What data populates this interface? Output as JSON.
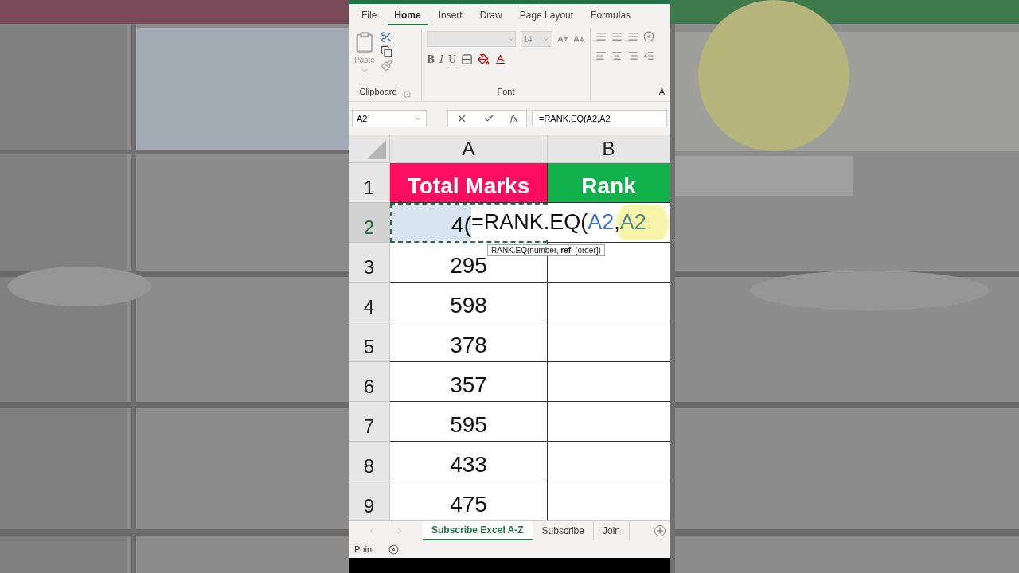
{
  "menu_tabs": [
    {
      "label": "File",
      "selected": false
    },
    {
      "label": "Home",
      "selected": true
    },
    {
      "label": "Insert",
      "selected": false
    },
    {
      "label": "Draw",
      "selected": false
    },
    {
      "label": "Page Layout",
      "selected": false
    },
    {
      "label": "Formulas",
      "selected": false
    }
  ],
  "ribbon": {
    "clipboard": {
      "paste_label": "Paste",
      "group_label": "Clipboard"
    },
    "font": {
      "font_size": "14",
      "style_buttons": [
        "B",
        "I",
        "U"
      ],
      "group_label": "Font"
    },
    "alignment": {
      "group_label": "A"
    }
  },
  "formula_bar": {
    "name_box": "A2",
    "fx": "fx",
    "formula": "=RANK.EQ(A2,A2"
  },
  "columns": [
    "A",
    "B"
  ],
  "rows": [
    {
      "number": "1",
      "kind": "header",
      "cells": [
        {
          "text": "Total Marks",
          "color": "#fc0d5f"
        },
        {
          "text": "Rank",
          "color": "#10b04a"
        }
      ]
    },
    {
      "number": "2",
      "kind": "editing",
      "cells": [
        {
          "text": "4("
        },
        {
          "text": ""
        }
      ]
    },
    {
      "number": "3",
      "kind": "value",
      "cells": [
        {
          "text": "295"
        }
      ]
    },
    {
      "number": "4",
      "kind": "value",
      "cells": [
        {
          "text": "598"
        }
      ]
    },
    {
      "number": "5",
      "kind": "value",
      "cells": [
        {
          "text": "378"
        }
      ]
    },
    {
      "number": "6",
      "kind": "value",
      "cells": [
        {
          "text": "357"
        }
      ]
    },
    {
      "number": "7",
      "kind": "value",
      "cells": [
        {
          "text": "595"
        }
      ]
    },
    {
      "number": "8",
      "kind": "value",
      "cells": [
        {
          "text": "433"
        }
      ]
    },
    {
      "number": "9",
      "kind": "value",
      "cells": [
        {
          "text": "475"
        }
      ]
    }
  ],
  "cell_editor": {
    "segments": [
      {
        "text": "=RANK.EQ(",
        "color": "#111111"
      },
      {
        "text": "A2",
        "color": "#3b6fd0"
      },
      {
        "text": ",",
        "color": "#111111"
      },
      {
        "text": "A2",
        "color": "#4f8a8b"
      }
    ],
    "tooltip": "RANK.EQ(number, **ref**, [order])"
  },
  "sheet_tabs": [
    {
      "label": "Subscribe Excel A-Z",
      "selected": true
    },
    {
      "label": "Subscribe",
      "selected": false
    },
    {
      "label": "Join",
      "selected": false
    }
  ],
  "status_bar": {
    "mode": "Point"
  }
}
